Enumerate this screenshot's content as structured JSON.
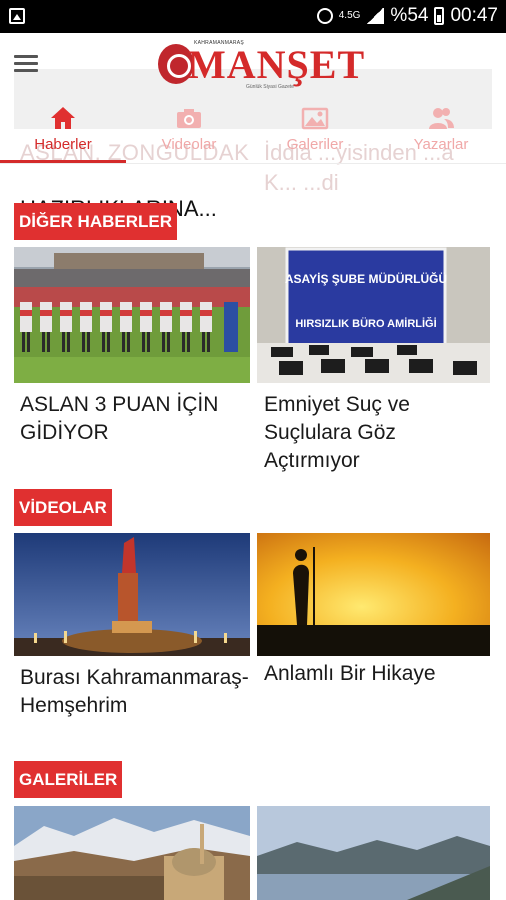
{
  "status_bar": {
    "network": "4.5G",
    "battery": "%54",
    "time": "00:47"
  },
  "app": {
    "logo_text": "MANŞET",
    "logo_top_text": "KAHRAMANMARAŞ",
    "logo_sub_text": "Günlük Siyasi Gazete"
  },
  "background_headlines": {
    "left_line1": "ASLAN, ZONGULDAK",
    "left_line3": "HAZIRLIKLARINA...",
    "right_line1": "İddia ...yisinden ...a",
    "right_line2": "K... ...di"
  },
  "tabs": [
    {
      "label": "Haberler",
      "icon": "home-icon",
      "active": true
    },
    {
      "label": "Videolar",
      "icon": "camera-icon",
      "active": false
    },
    {
      "label": "Galeriler",
      "icon": "gallery-icon",
      "active": false
    },
    {
      "label": "Yazarlar",
      "icon": "authors-icon",
      "active": false
    }
  ],
  "sections": {
    "other_news": {
      "label": "DİĞER HABERLER",
      "items": [
        {
          "title": "ASLAN 3 PUAN İÇİN GİDİYOR"
        },
        {
          "title": "Emniyet Suç ve Suçlulara Göz Açtırmıyor",
          "image_sign_line1": "ASAYİŞ ŞUBE MÜDÜRLÜĞÜ",
          "image_sign_line2": "HIRSIZLIK BÜRO AMİRLİĞİ"
        }
      ]
    },
    "videos": {
      "label": "VİDEOLAR",
      "items": [
        {
          "title": "Burası Kahramanmaraş-Hemşehrim"
        },
        {
          "title": "Anlamlı Bir Hikaye"
        }
      ]
    },
    "galleries": {
      "label": "GALERİLER"
    }
  },
  "colors": {
    "accent": "#e03030",
    "tab_inactive": "#f0a8a8"
  }
}
